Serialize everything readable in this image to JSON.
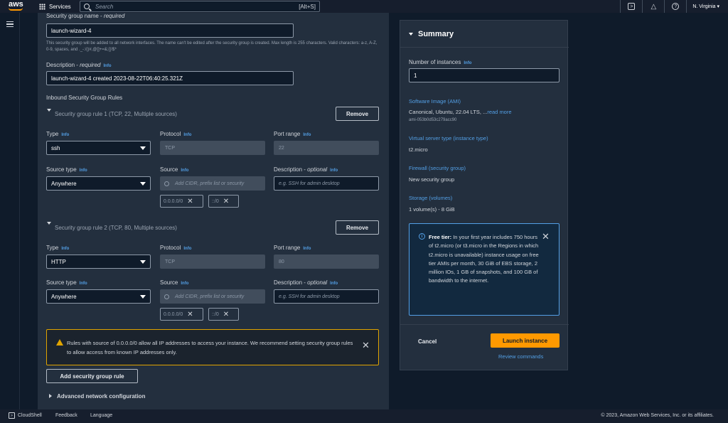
{
  "topbar": {
    "logo": "aws",
    "services_label": "Services",
    "search_placeholder": "Search",
    "search_shortcut": "[Alt+S]",
    "region": "N. Virginia",
    "icons": [
      "cloudshell-icon",
      "bell-icon",
      "help-icon"
    ]
  },
  "security_group": {
    "name_label": "Security group name",
    "name_required": "required",
    "name_value": "launch-wizard-4",
    "name_hint": "This security group will be added to all network interfaces. The name can't be edited after the security group is created. Max length is 255 characters. Valid characters: a-z, A-Z, 0-9, spaces, and ._-:/()#,@[]+=&;{}!$*",
    "description_label": "Description",
    "description_required": "required",
    "description_value": "launch-wizard-4 created 2023-08-22T06:40:25.321Z",
    "info": "Info",
    "inbound_title": "Inbound Security Group Rules"
  },
  "rules": [
    {
      "title": "Security group rule 1 (TCP, 22, Multiple sources)",
      "remove_label": "Remove",
      "type_label": "Type",
      "type_value": "ssh",
      "protocol_label": "Protocol",
      "protocol_value": "TCP",
      "port_label": "Port range",
      "port_value": "22",
      "source_type_label": "Source type",
      "source_type_value": "Anywhere",
      "source_label": "Source",
      "source_placeholder": "Add CIDR, prefix list or security",
      "desc_label": "Description",
      "desc_optional": "optional",
      "desc_placeholder": "e.g. SSH for admin desktop",
      "tags": [
        "0.0.0.0/0",
        "::/0"
      ]
    },
    {
      "title": "Security group rule 2 (TCP, 80, Multiple sources)",
      "remove_label": "Remove",
      "type_label": "Type",
      "type_value": "HTTP",
      "protocol_label": "Protocol",
      "protocol_value": "TCP",
      "port_label": "Port range",
      "port_value": "80",
      "source_type_label": "Source type",
      "source_type_value": "Anywhere",
      "source_label": "Source",
      "source_placeholder": "Add CIDR, prefix list or security",
      "desc_label": "Description",
      "desc_optional": "optional",
      "desc_placeholder": "e.g. SSH for admin desktop",
      "tags": [
        "0.0.0.0/0",
        "::/0"
      ]
    }
  ],
  "warning": {
    "text": "Rules with source of 0.0.0.0/0 allow all IP addresses to access your instance. We recommend setting security group rules to allow access from known IP addresses only."
  },
  "add_rule_label": "Add security group rule",
  "advanced_label": "Advanced network configuration",
  "summary": {
    "title": "Summary",
    "instances_label": "Number of instances",
    "info": "Info",
    "instances_value": "1",
    "ami_label": "Software Image (AMI)",
    "ami_value": "Canonical, Ubuntu, 22.04 LTS, ...",
    "read_more": "read more",
    "ami_id": "ami-053b0d53c279acc90",
    "server_type_label": "Virtual server type (instance type)",
    "server_type_value": "t2.micro",
    "firewall_label": "Firewall (security group)",
    "firewall_value": "New security group",
    "storage_label": "Storage (volumes)",
    "storage_value": "1 volume(s) - 8 GiB",
    "free_tier_bold": "Free tier:",
    "free_tier_text": "In your first year includes 750 hours of t2.micro (or t3.micro in the Regions in which t2.micro is unavailable) instance usage on free tier AMIs per month, 30 GiB of EBS storage, 2 million IOs, 1 GB of snapshots, and 100 GB of bandwidth to the internet.",
    "cancel_label": "Cancel",
    "launch_label": "Launch instance",
    "review_label": "Review commands"
  },
  "footer": {
    "cloudshell": "CloudShell",
    "feedback": "Feedback",
    "language": "Language",
    "copyright": "© 2023, Amazon Web Services, Inc. or its affiliates."
  },
  "colors": {
    "accent_orange": "#ff9900",
    "link_blue": "#539fe5",
    "warning_yellow": "#e0a400",
    "panel_bg": "#232f3e",
    "page_bg": "#0f1b2a"
  }
}
